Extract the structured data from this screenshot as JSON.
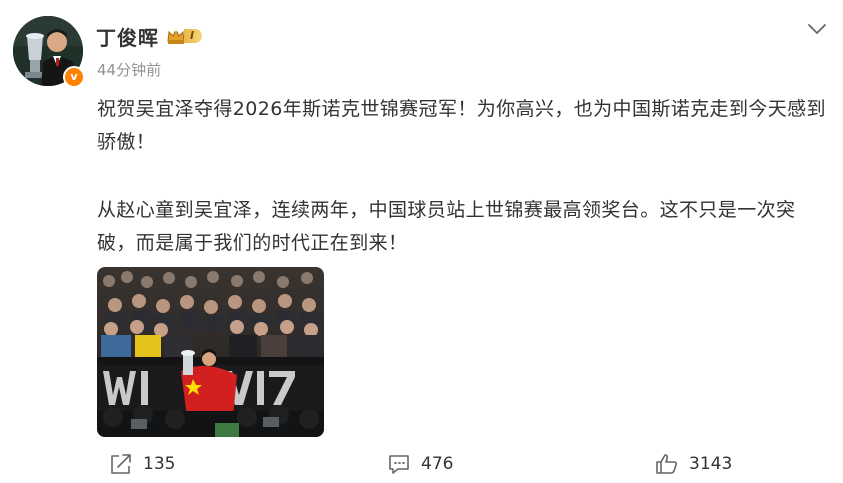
{
  "user": {
    "name": "丁俊晖",
    "level": "I",
    "verified_mark": "v",
    "timestamp": "44分钟前"
  },
  "post": {
    "paragraphs": [
      "祝贺吴宜泽夺得2026年斯诺克世锦赛冠军！为你高兴，也为中国斯诺克走到今天感到骄傲！",
      "从赵心童到吴宜泽，连续两年，中国球员站上世锦赛最高领奖台。这不只是一次突破，而是属于我们的时代正在到来！"
    ],
    "photo_banner_text": "WI  VI7"
  },
  "footer": {
    "repost_count": "135",
    "comment_count": "476",
    "like_count": "3143"
  },
  "icons": {
    "more": "chevron-down-icon",
    "repost": "share-arrow-icon",
    "comment": "comment-bubble-icon",
    "like": "thumbs-up-icon",
    "level": "crown-icon"
  },
  "colors": {
    "accent": "#ff8200",
    "muted_text": "#939393",
    "level_gold": "#e9b84a"
  }
}
